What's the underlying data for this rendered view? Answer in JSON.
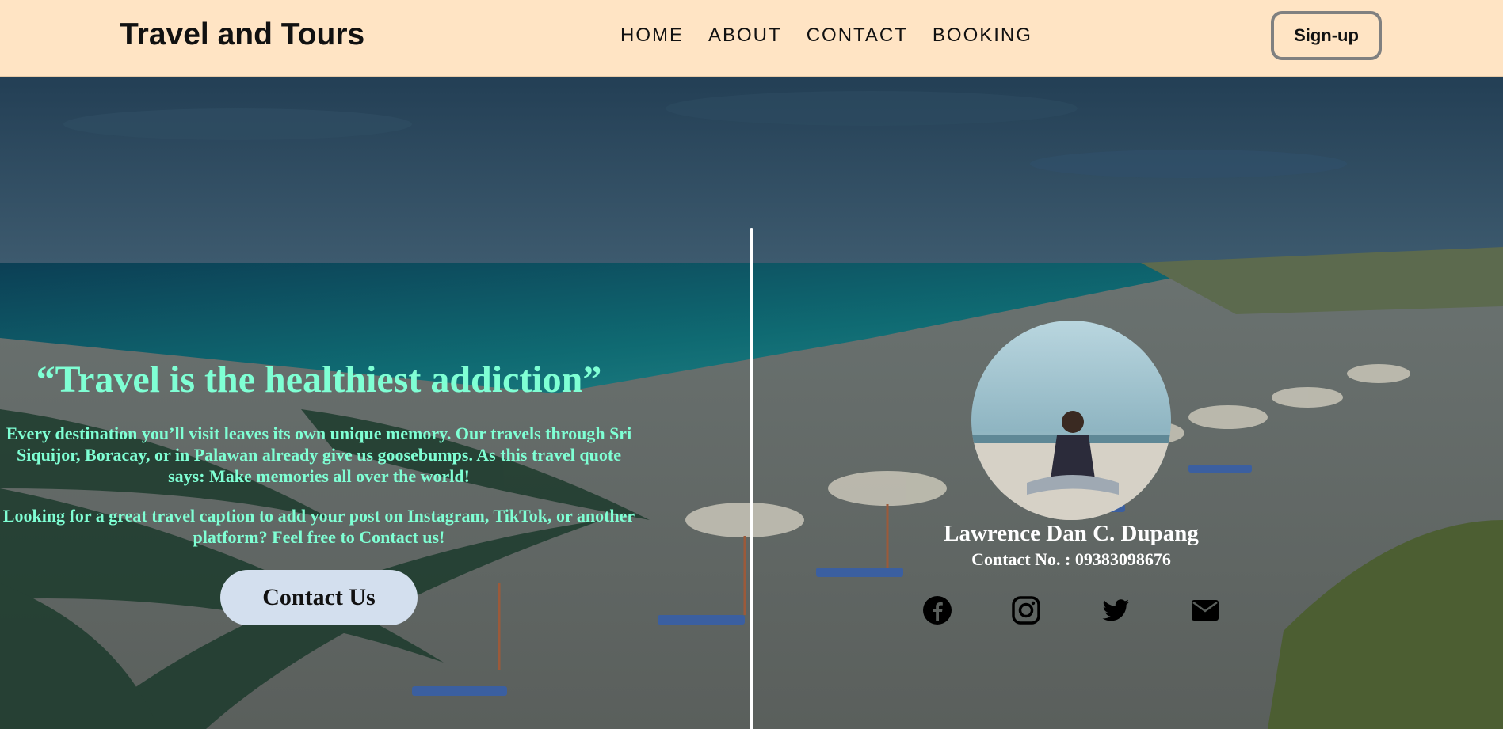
{
  "header": {
    "brand": "Travel and Tours",
    "nav": [
      "HOME",
      "ABOUT",
      "CONTACT",
      "BOOKING"
    ],
    "signup_label": "Sign-up",
    "background": "#ffe4c4"
  },
  "hero": {
    "quote": "“Travel is the healthiest addiction”",
    "paragraph1": "Every destination you’ll visit leaves its own unique memory. Our travels through Sri Siquijor, Boracay, or in Palawan already give us goosebumps. As this travel quote says: Make memories all over the world!",
    "paragraph2": "Looking for a great travel caption to add your post on Instagram, TikTok, or another platform? Feel free to Contact us!",
    "contact_button": "Contact Us",
    "text_color": "#7fffd4"
  },
  "profile": {
    "name": "Lawrence Dan C. Dupang",
    "contact": "Contact No. : 09383098676",
    "socials": [
      "facebook-icon",
      "instagram-icon",
      "twitter-icon",
      "email-icon"
    ]
  }
}
